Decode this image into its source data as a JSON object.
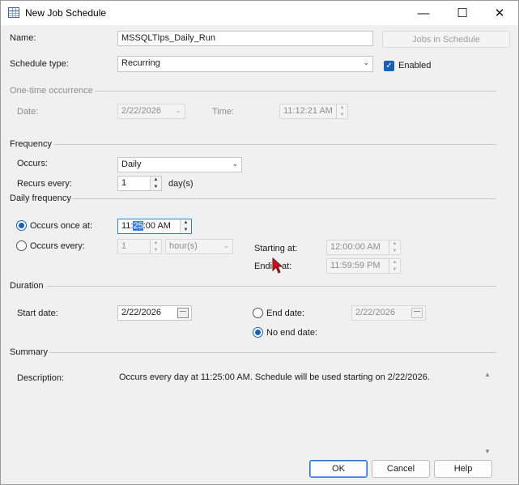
{
  "window": {
    "title": "New Job Schedule",
    "minimize_glyph": "—",
    "maximize_glyph": "☐",
    "close_glyph": "✕"
  },
  "name": {
    "label": "Name:",
    "value": "MSSQLTIps_Daily_Run"
  },
  "jobs_in_schedule": {
    "label": "Jobs in Schedule"
  },
  "schedule_type": {
    "label": "Schedule type:",
    "value": "Recurring"
  },
  "enabled": {
    "label": "Enabled",
    "checked": true
  },
  "one_time": {
    "section": "One-time occurrence",
    "date_label": "Date:",
    "date_value": "2/22/2026",
    "time_label": "Time:",
    "time_value": "11:12:21 AM"
  },
  "frequency": {
    "section": "Frequency",
    "occurs_label": "Occurs:",
    "occurs_value": "Daily",
    "recurs_label": "Recurs every:",
    "recurs_value": "1",
    "recurs_unit": "day(s)"
  },
  "daily_frequency": {
    "section": "Daily frequency",
    "once_label": "Occurs once at:",
    "once_time_pre": "11:",
    "once_time_sel": "25",
    "once_time_post": ":00 AM",
    "every_label": "Occurs every:",
    "every_value": "1",
    "every_unit": "hour(s)",
    "starting_label": "Starting at:",
    "starting_value": "12:00:00 AM",
    "ending_label_a": "Endi",
    "ending_label_b": "at:",
    "ending_value": "11:59:59 PM",
    "selected": "once"
  },
  "duration": {
    "section": "Duration",
    "start_label": "Start date:",
    "start_value": "2/22/2026",
    "end_label": "End date:",
    "end_value": "2/22/2026",
    "no_end_label": "No end date:",
    "selected": "no_end"
  },
  "summary": {
    "section": "Summary",
    "description_label": "Description:",
    "description": "Occurs every day at 11:25:00 AM. Schedule will be used starting on 2/22/2026."
  },
  "buttons": {
    "ok": "OK",
    "cancel": "Cancel",
    "help": "Help"
  },
  "colors": {
    "accent": "#1a5fb4",
    "cursor": "#c8141e"
  }
}
